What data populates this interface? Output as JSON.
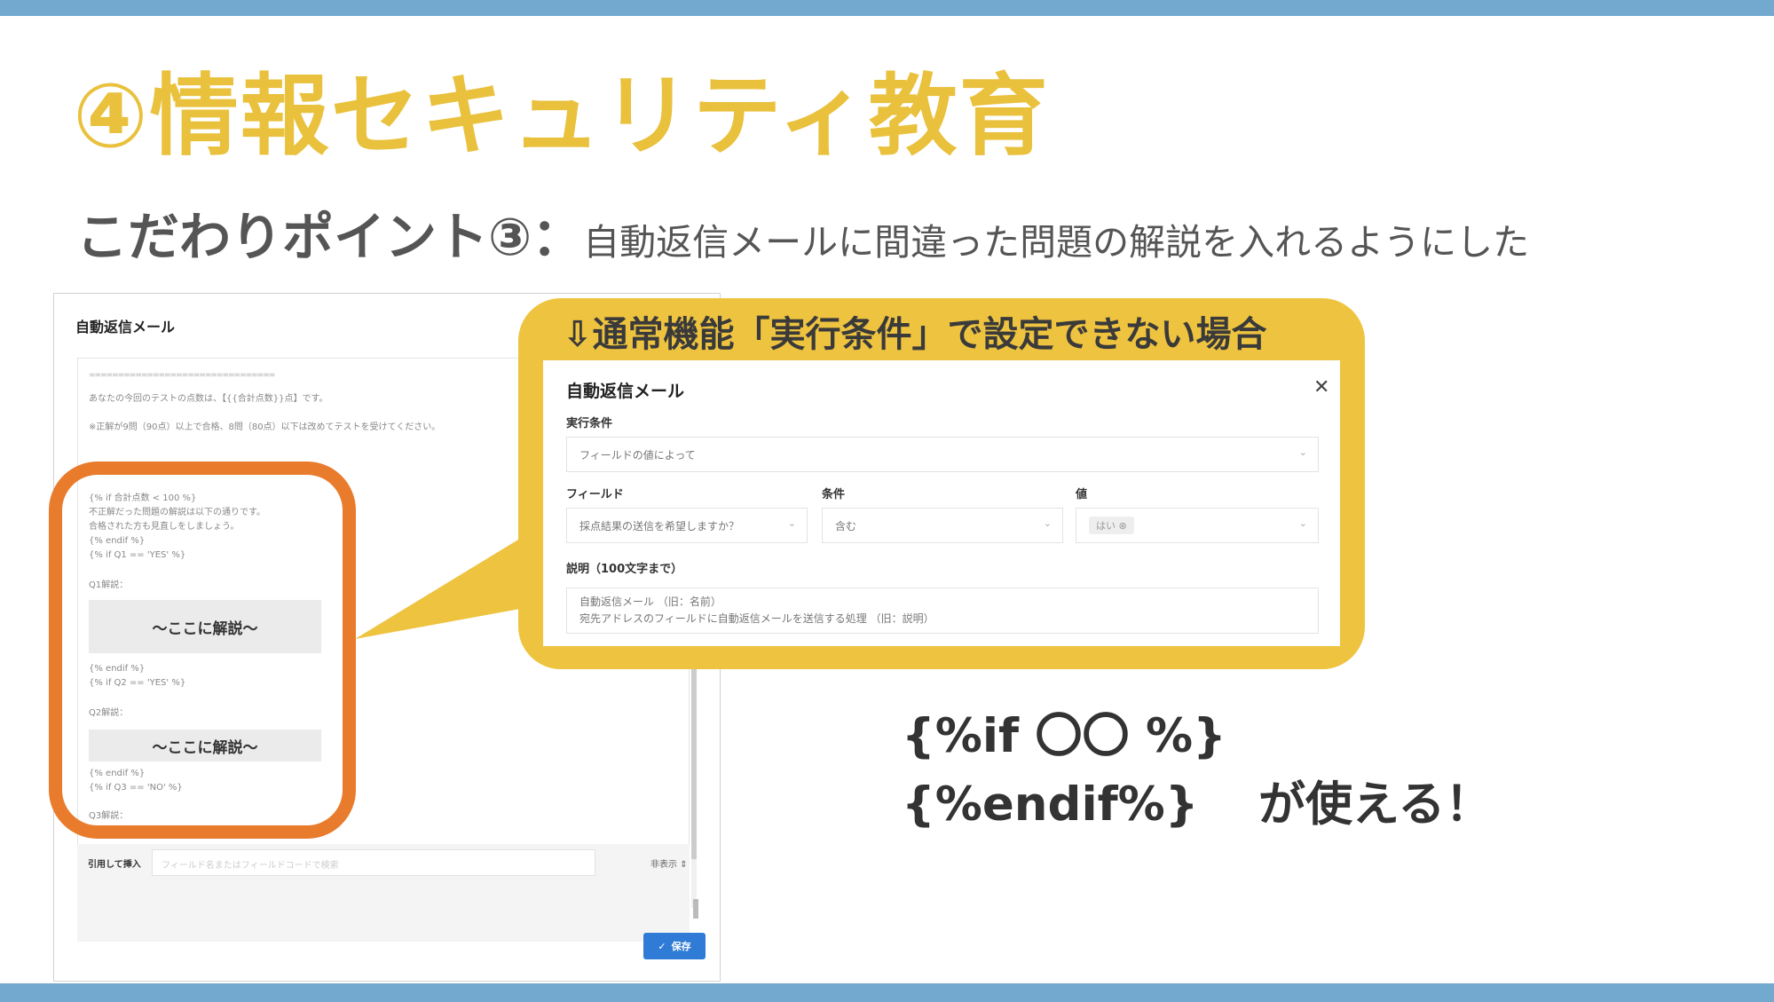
{
  "slide": {
    "title": "④情報セキュリティ教育",
    "subtitle_lead": "こだわりポイント③：",
    "subtitle_rest": "自動返信メールに間違った問題の解説を入れるようにした",
    "code_if": "{%if 〇〇 %}",
    "code_endif": "{%endif%}",
    "uses_text": "が使える！"
  },
  "screenshot": {
    "title": "自動返信メール",
    "separator": "================================",
    "line_score": "あなたの今回のテストの点数は、【{{合計点数}}点】です。",
    "line_note": "※正解が9問（90点）以上で合格、8問（80点）以下は改めてテストを受けてください。",
    "code_lines": [
      "{% if 合計点数 < 100 %}",
      "不正解だった問題の解説は以下の通りです。",
      "合格された方も見直しをしましょう。",
      "{% endif %}",
      "{% if Q1 == 'YES' %}"
    ],
    "q1_label": "Q1解説：",
    "explain_box": "～ここに解説～",
    "after_q1": [
      "{% endif %}",
      "{% if Q2 == 'YES' %}"
    ],
    "q2_label": "Q2解説：",
    "after_q2": [
      "{% endif %}",
      "{% if Q3 == 'NO' %}"
    ],
    "q3_label": "Q3解説：",
    "insert_label": "引用して挿入",
    "insert_placeholder": "フィールド名またはフィールドコードで検索",
    "hide_label": "非表示",
    "save_label": "保存"
  },
  "callout": {
    "heading": "⇩通常機能「実行条件」で設定できない場合",
    "dialog": {
      "title": "自動返信メール",
      "exec_label": "実行条件",
      "exec_value": "フィールドの値によって",
      "field_label": "フィールド",
      "field_value": "採点結果の送信を希望しますか？",
      "cond_label": "条件",
      "cond_value": "含む",
      "value_label": "値",
      "value_pill": "はい ⊗",
      "desc_label": "説明（100文字まで）",
      "desc_line1": "自動返信メール （旧：名前）",
      "desc_line2": "宛先アドレスのフィールドに自動返信メールを送信する処理 （旧：説明）"
    }
  },
  "colors": {
    "title": "#e9c13d",
    "callout": "#eec340",
    "highlight": "#e87b2c",
    "bar": "#73a9cf",
    "save": "#2f7bd6"
  },
  "icons": {
    "close": "close-icon",
    "chevron": "chevron-down-icon",
    "check": "check-icon",
    "collapse": "collapse-icon"
  }
}
